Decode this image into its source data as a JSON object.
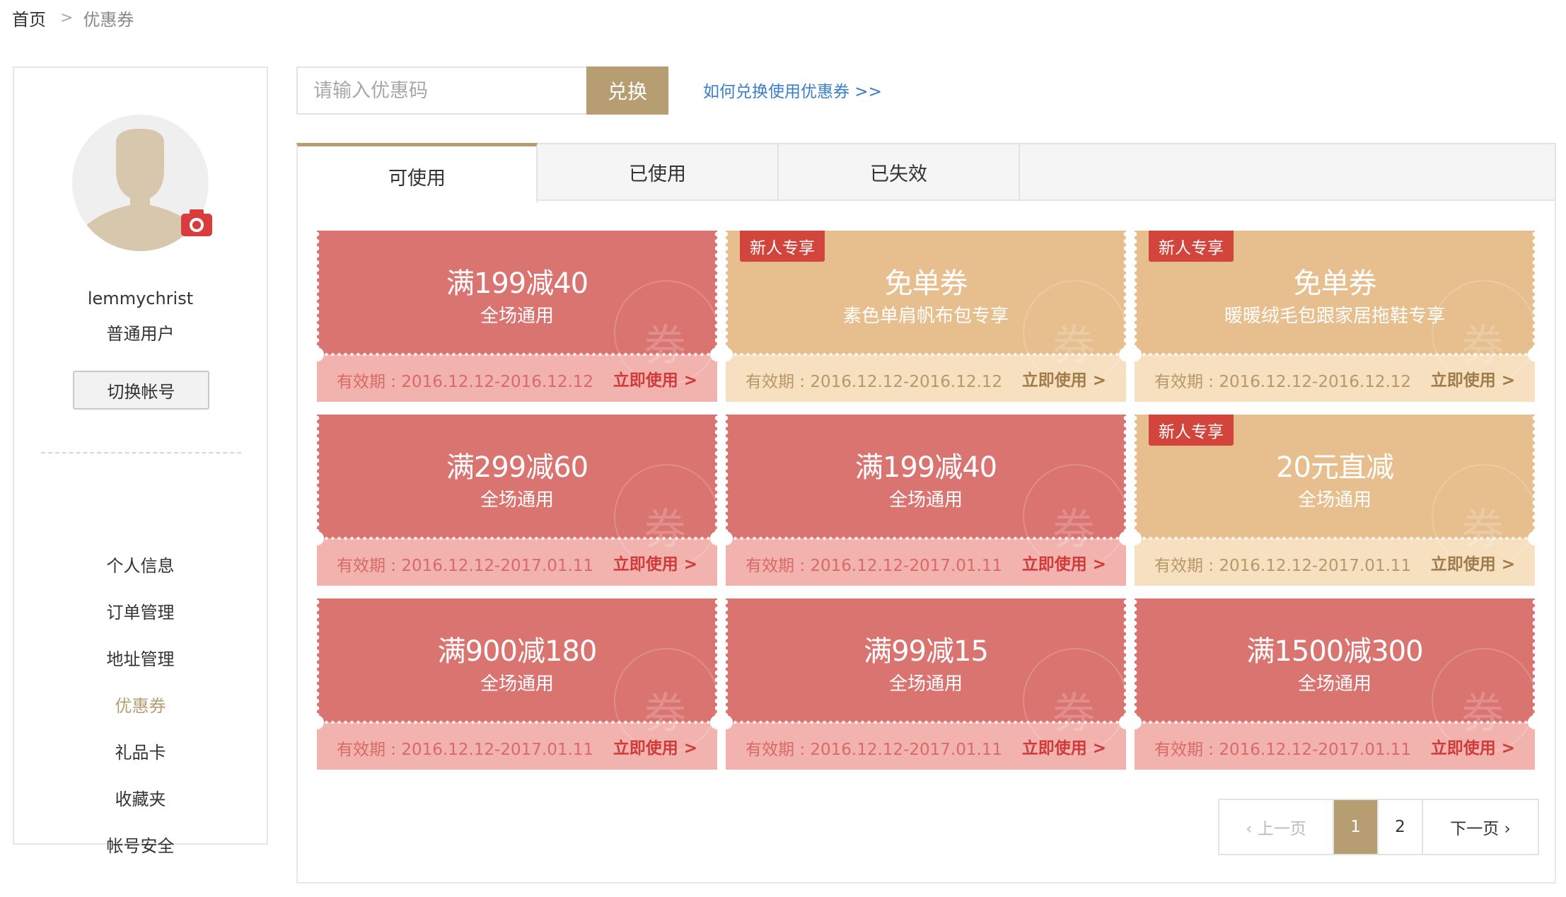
{
  "breadcrumb": {
    "home": "首页",
    "separator": ">",
    "current": "优惠券"
  },
  "sidebar": {
    "avatar_icon": "user-silhouette-icon",
    "camera_icon": "camera-icon",
    "username": "lemmychrist",
    "user_type": "普通用户",
    "switch_account": "切换帐号",
    "menu": [
      {
        "label": "个人信息",
        "active": false
      },
      {
        "label": "订单管理",
        "active": false
      },
      {
        "label": "地址管理",
        "active": false
      },
      {
        "label": "优惠券",
        "active": true
      },
      {
        "label": "礼品卡",
        "active": false
      },
      {
        "label": "收藏夹",
        "active": false
      },
      {
        "label": "帐号安全",
        "active": false
      }
    ]
  },
  "redeem": {
    "placeholder": "请输入优惠码",
    "button": "兑换",
    "help_link": "如何兑换使用优惠券 >>"
  },
  "tabs": [
    {
      "label": "可使用",
      "active": true
    },
    {
      "label": "已使用",
      "active": false
    },
    {
      "label": "已失效",
      "active": false
    }
  ],
  "coupons": [
    {
      "style": "red",
      "badge": "",
      "title": "满199减40",
      "subtitle": "全场通用",
      "validity": "有效期 : 2016.12.12-2016.12.12",
      "action": "立即使用 >"
    },
    {
      "style": "gold",
      "badge": "新人专享",
      "title": "免单券",
      "subtitle": "素色单肩帆布包专享",
      "validity": "有效期 : 2016.12.12-2016.12.12",
      "action": "立即使用 >"
    },
    {
      "style": "gold",
      "badge": "新人专享",
      "title": "免单券",
      "subtitle": "暖暖绒毛包跟家居拖鞋专享",
      "validity": "有效期 : 2016.12.12-2016.12.12",
      "action": "立即使用 >"
    },
    {
      "style": "red",
      "badge": "",
      "title": "满299减60",
      "subtitle": "全场通用",
      "validity": "有效期 : 2016.12.12-2017.01.11",
      "action": "立即使用 >"
    },
    {
      "style": "red",
      "badge": "",
      "title": "满199减40",
      "subtitle": "全场通用",
      "validity": "有效期 : 2016.12.12-2017.01.11",
      "action": "立即使用 >"
    },
    {
      "style": "gold",
      "badge": "新人专享",
      "title": "20元直减",
      "subtitle": "全场通用",
      "validity": "有效期 : 2016.12.12-2017.01.11",
      "action": "立即使用 >"
    },
    {
      "style": "red",
      "badge": "",
      "title": "满900减180",
      "subtitle": "全场通用",
      "validity": "有效期 : 2016.12.12-2017.01.11",
      "action": "立即使用 >"
    },
    {
      "style": "red",
      "badge": "",
      "title": "满99减15",
      "subtitle": "全场通用",
      "validity": "有效期 : 2016.12.12-2017.01.11",
      "action": "立即使用 >"
    },
    {
      "style": "red",
      "badge": "",
      "title": "满1500减300",
      "subtitle": "全场通用",
      "validity": "有效期 : 2016.12.12-2017.01.11",
      "action": "立即使用 >"
    }
  ],
  "coupon_watermark": "券",
  "pagination": {
    "prev": "‹ 上一页",
    "pages": [
      "1",
      "2"
    ],
    "current": "1",
    "next": "下一页 ›"
  },
  "colors": {
    "accent": "#b69e72",
    "coupon_red": "#da7470",
    "coupon_gold": "#e7bf8e",
    "badge": "#d2453d",
    "link": "#3a7ec7"
  }
}
